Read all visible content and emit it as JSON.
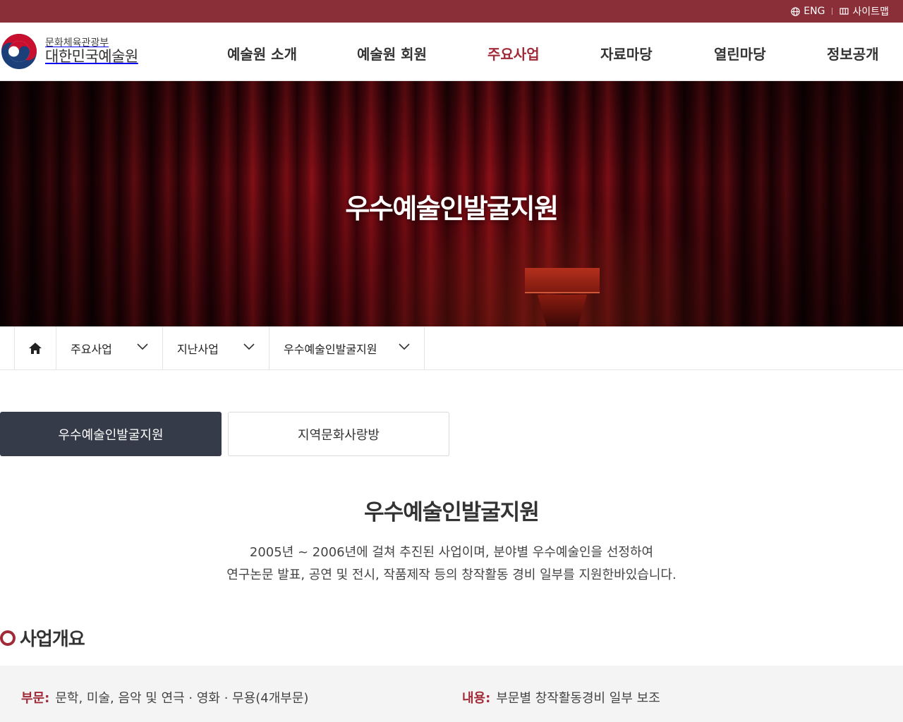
{
  "topbar": {
    "eng_label": "ENG",
    "sitemap_label": "사이트맵"
  },
  "header": {
    "ministry": "문화체육관광부",
    "org_name": "대한민국예술원"
  },
  "nav": {
    "items": [
      {
        "label": "예술원 소개"
      },
      {
        "label": "예술원 회원"
      },
      {
        "label": "주요사업"
      },
      {
        "label": "자료마당"
      },
      {
        "label": "열린마당"
      },
      {
        "label": "정보공개"
      }
    ],
    "active_index": 2
  },
  "hero": {
    "title": "우수예술인발굴지원"
  },
  "breadcrumb": {
    "items": [
      {
        "label": "주요사업"
      },
      {
        "label": "지난사업"
      },
      {
        "label": "우수예술인발굴지원"
      }
    ]
  },
  "tabs": [
    {
      "label": "우수예술인발굴지원",
      "active": true
    },
    {
      "label": "지역문화사랑방",
      "active": false
    }
  ],
  "content": {
    "title": "우수예술인발굴지원",
    "desc_line1": "2005년 ~ 2006년에 걸쳐 추진된 사업이며, 분야별 우수예술인을 선정하여",
    "desc_line2": "연구논문 발표, 공연 및 전시, 작품제작 등의 창작활동 경비 일부를 지원한바있습니다."
  },
  "overview": {
    "heading": "사업개요",
    "field_label": "부문:",
    "field_value": "문학, 미술, 음악 및 연극 · 영화 · 무용(4개부문)",
    "content_label": "내용:",
    "content_value": "부문별 창작활동경비 일부 보조"
  },
  "colors": {
    "brand": "#8a2e38",
    "accent": "#a02a37",
    "tab_active_bg": "#353b48"
  }
}
